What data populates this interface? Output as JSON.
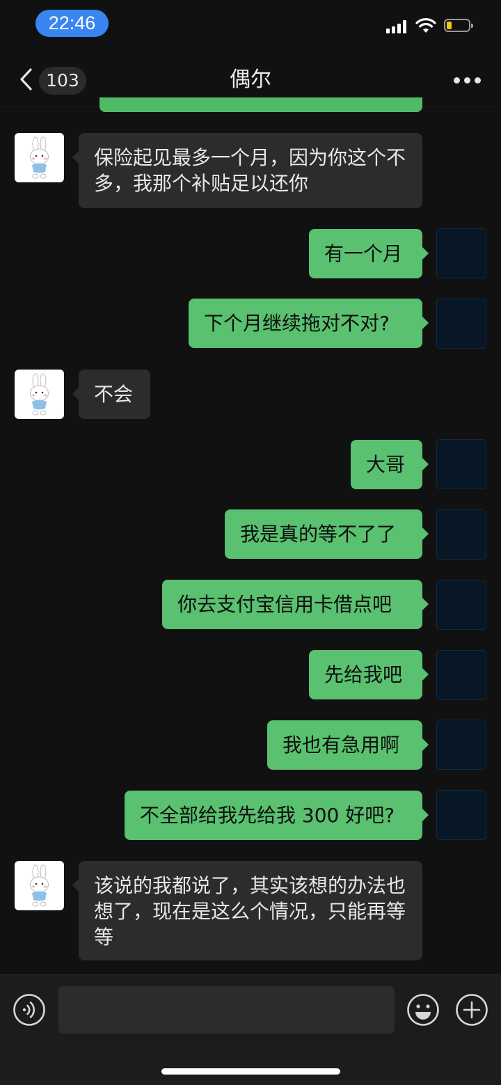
{
  "status_bar": {
    "time": "22:46"
  },
  "nav": {
    "back_count": "103",
    "title": "偶尔"
  },
  "messages": [
    {
      "side": "in",
      "text": "保险起见最多一个月，因为你这个不多，我那个补贴足以还你"
    },
    {
      "side": "out",
      "text": "有一个月"
    },
    {
      "side": "out",
      "text": "下个月继续拖对不对?"
    },
    {
      "side": "in",
      "text": "不会"
    },
    {
      "side": "out",
      "text": "大哥"
    },
    {
      "side": "out",
      "text": "我是真的等不了了"
    },
    {
      "side": "out",
      "text": "你去支付宝信用卡借点吧"
    },
    {
      "side": "out",
      "text": "先给我吧"
    },
    {
      "side": "out",
      "text": "我也有急用啊"
    },
    {
      "side": "out",
      "text": "不全部给我先给我 300 好吧?"
    },
    {
      "side": "in",
      "text": "该说的我都说了，其实该想的办法也想了，现在是这么个情况，只能再等等"
    }
  ],
  "colors": {
    "background": "#111111",
    "outgoing_bubble": "#59c16f",
    "incoming_bubble": "#2c2c2c",
    "time_pill": "#3a86f0",
    "battery_low": "#f5c518"
  },
  "icons": [
    "back-chevron-icon",
    "more-dots-icon",
    "voice-icon",
    "emoji-icon",
    "plus-icon",
    "signal-icon",
    "wifi-icon",
    "battery-icon",
    "rabbit-avatar"
  ]
}
